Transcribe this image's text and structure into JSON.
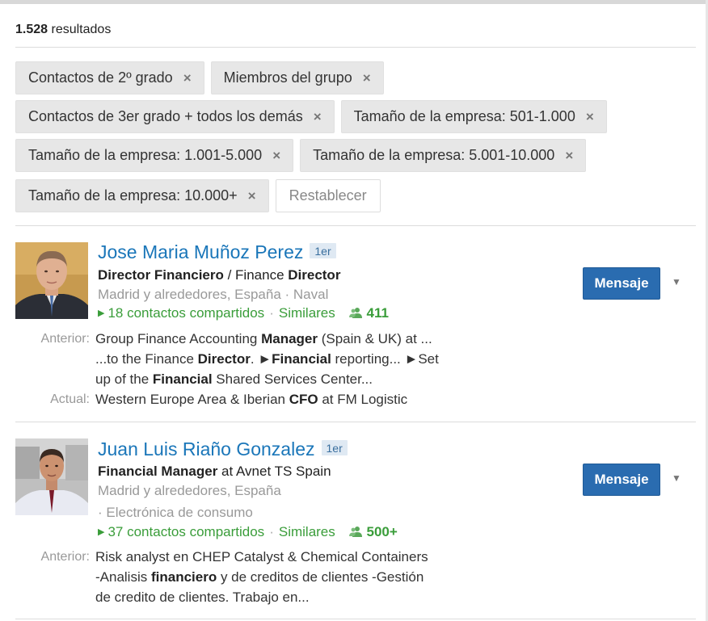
{
  "results": {
    "count": "1.528",
    "label": "resultados"
  },
  "filters": [
    {
      "label": "Contactos de 2º grado"
    },
    {
      "label": "Miembros del grupo"
    },
    {
      "label": "Contactos de 3er grado + todos los demás"
    },
    {
      "label": "Tamaño de la empresa: 501-1.000"
    },
    {
      "label": "Tamaño de la empresa: 1.001-5.000"
    },
    {
      "label": "Tamaño de la empresa: 5.001-10.000"
    },
    {
      "label": "Tamaño de la empresa: 10.000+"
    }
  ],
  "filter_remove_glyph": "×",
  "reset_label": "Restablecer",
  "people": [
    {
      "name": "Jose Maria Muñoz Perez",
      "degree": "1er",
      "headline_parts": [
        "Director Financiero",
        " / Finance ",
        "Director"
      ],
      "location": "Madrid y alrededores, España · Naval",
      "shared_connections": "18 contactos compartidos",
      "similar": "Similares",
      "connections": "411",
      "previous_label": "Anterior:",
      "previous_lines": [
        [
          "Group Finance Accounting ",
          "Manager",
          " (Spain & UK) at ..."
        ],
        [
          "...to the Finance ",
          "Director",
          ". ►",
          "Financial",
          " reporting... ►Set"
        ],
        [
          "up of the ",
          "Financial",
          " Shared Services Center..."
        ]
      ],
      "current_label": "Actual:",
      "current_parts": [
        "Western Europe Area & Iberian ",
        "CFO",
        " at FM Logistic"
      ],
      "message_label": "Mensaje"
    },
    {
      "name": "Juan Luis Riaño Gonzalez",
      "degree": "1er",
      "headline_parts": [
        "Financial Manager",
        " at Avnet TS Spain"
      ],
      "location": "Madrid y alrededores, España",
      "industry": "· Electrónica de consumo",
      "shared_connections": "37 contactos compartidos",
      "similar": "Similares",
      "connections": "500+",
      "previous_label": "Anterior:",
      "previous_lines": [
        [
          "Risk analyst en CHEP Catalyst & Chemical Containers"
        ],
        [
          "-Analisis ",
          "financiero",
          " y de creditos de clientes -Gestión"
        ],
        [
          "de credito de clientes. Trabajo en..."
        ]
      ],
      "message_label": "Mensaje"
    }
  ],
  "colors": {
    "link": "#1a76b9",
    "green": "#3a9d3a",
    "button": "#2a6cb0"
  }
}
